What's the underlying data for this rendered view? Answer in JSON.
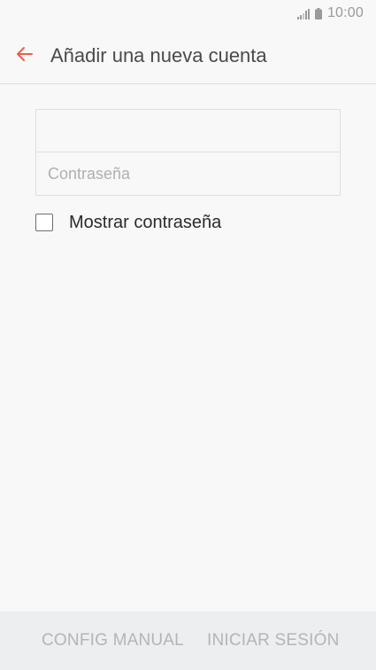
{
  "status_bar": {
    "time": "10:00",
    "icons": [
      "signal-icon",
      "battery-icon"
    ],
    "icon_color": "#9a9a9a"
  },
  "header": {
    "title": "Añadir una nueva cuenta",
    "back_icon": "arrow-left-icon",
    "accent_color": "#e8604a"
  },
  "form": {
    "username": {
      "value": "",
      "placeholder": ""
    },
    "password": {
      "value": "",
      "placeholder": "Contraseña"
    },
    "show_password": {
      "label": "Mostrar contraseña",
      "checked": false
    }
  },
  "footer": {
    "manual_label": "CONFIG MANUAL",
    "signin_label": "INICIAR SESIÓN"
  }
}
